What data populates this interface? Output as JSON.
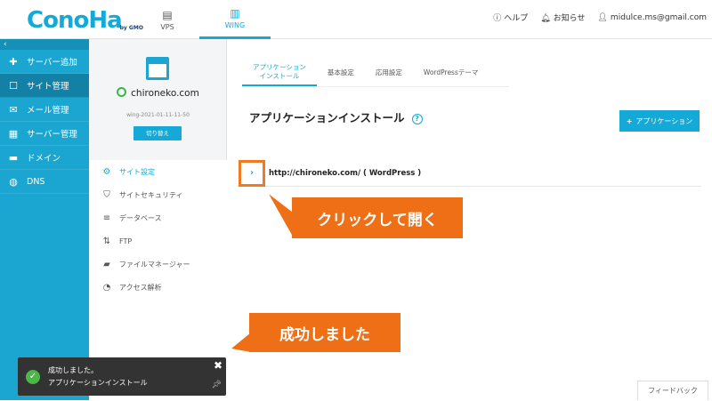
{
  "brand": {
    "logo": "ConoHa",
    "logo_sub": "by GMO"
  },
  "topnav": [
    {
      "label": "VPS",
      "icon": "server-stack-icon"
    },
    {
      "label": "WING",
      "icon": "wing-building-icon"
    }
  ],
  "topright": {
    "help": "ヘルプ",
    "notice": "お知らせ",
    "user": "midulce.ms@gmail.com"
  },
  "sidebar": {
    "collapse": "‹",
    "items": [
      {
        "label": "サーバー追加",
        "icon": "plus-icon"
      },
      {
        "label": "サイト管理",
        "icon": "window-icon"
      },
      {
        "label": "メール管理",
        "icon": "mail-icon"
      },
      {
        "label": "サーバー管理",
        "icon": "server-icon"
      },
      {
        "label": "ドメイン",
        "icon": "domain-icon"
      },
      {
        "label": "DNS",
        "icon": "globe-icon"
      }
    ]
  },
  "server": {
    "name": "chironeko.com",
    "id": "wing-2021-01-11-11-50",
    "switch_label": "切り替え"
  },
  "submenu": [
    {
      "label": "サイト設定",
      "icon": "site-settings-icon"
    },
    {
      "label": "サイトセキュリティ",
      "icon": "shield-icon"
    },
    {
      "label": "データベース",
      "icon": "database-icon"
    },
    {
      "label": "FTP",
      "icon": "ftp-arrows-icon"
    },
    {
      "label": "ファイルマネージャー",
      "icon": "folder-icon"
    },
    {
      "label": "アクセス解析",
      "icon": "pie-chart-icon"
    }
  ],
  "tabs": [
    {
      "label1": "アプリケーション",
      "label2": "インストール"
    },
    {
      "label1": "基本設定",
      "label2": ""
    },
    {
      "label1": "応用設定",
      "label2": ""
    },
    {
      "label1": "WordPressテーマ",
      "label2": ""
    }
  ],
  "main": {
    "title": "アプリケーションインストール",
    "add_button": "アプリケーション",
    "app_url": "http://chironeko.com/ ( WordPress )"
  },
  "callouts": {
    "click_open": "クリックして開く",
    "success": "成功しました"
  },
  "toast": {
    "line1": "成功しました。",
    "line2": "アプリケーションインストール"
  },
  "feedback": "フィードバック",
  "colors": {
    "accent": "#14a9d6",
    "sidebar": "#1aa6d0",
    "callout": "#ef6f16",
    "success": "#4cb648"
  }
}
